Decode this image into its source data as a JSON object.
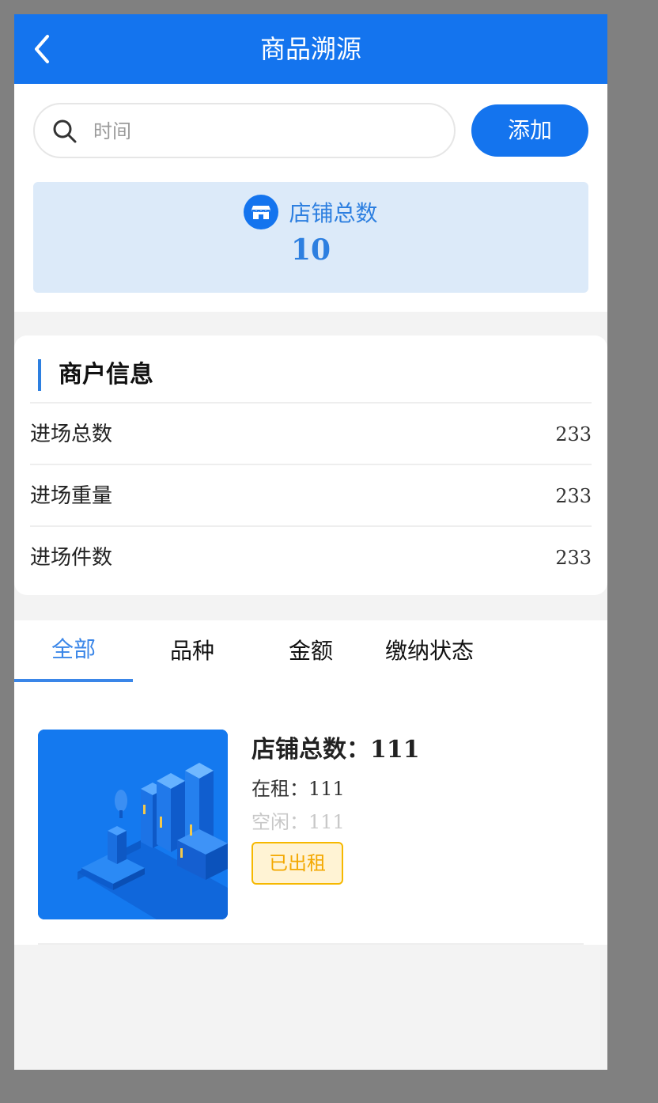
{
  "header": {
    "title": "商品溯源",
    "back_icon": "chevron-left-icon"
  },
  "search": {
    "placeholder": "时间",
    "value": "",
    "icon": "search-icon"
  },
  "add_button": {
    "label": "添加"
  },
  "store_summary": {
    "icon": "store-icon",
    "label": "店铺总数",
    "value": "10"
  },
  "merchant_info": {
    "title": "商户信息",
    "rows": [
      {
        "label": "进场总数",
        "value": "233"
      },
      {
        "label": "进场重量",
        "value": "233"
      },
      {
        "label": "进场件数",
        "value": "233"
      }
    ]
  },
  "tabs": [
    {
      "label": "全部",
      "active": true
    },
    {
      "label": "品种",
      "active": false
    },
    {
      "label": "金额",
      "active": false
    },
    {
      "label": "缴纳状态",
      "active": false
    }
  ],
  "list": [
    {
      "title_label": "店铺总数：",
      "title_value": "111",
      "rented_label": "在租：",
      "rented_value": "111",
      "idle_label": "空闲：",
      "idle_value": "111",
      "status": "已出租"
    }
  ],
  "colors": {
    "primary": "#1474ee",
    "stat_bg": "#dceaf9",
    "tab_active": "#3a86e8",
    "badge_border": "#f6b800",
    "badge_bg": "#fff3d4"
  }
}
